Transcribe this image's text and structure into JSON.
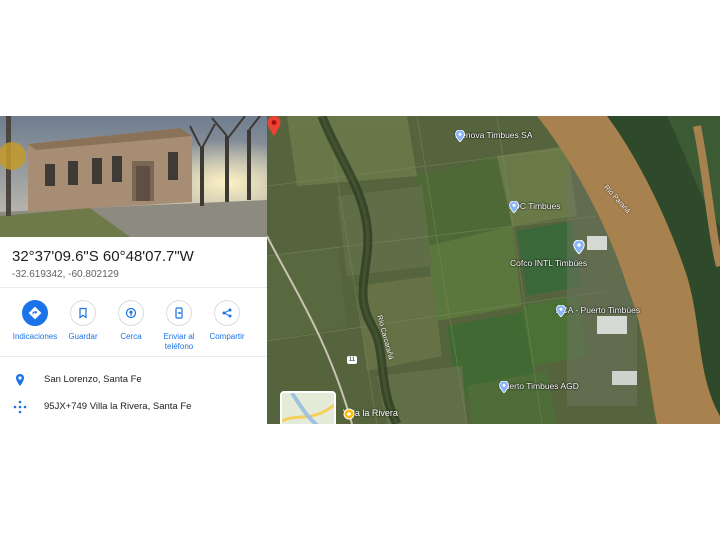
{
  "place": {
    "coordinates_dms": "32°37'09.6\"S 60°48'07.7\"W",
    "coordinates_decimal": "-32.619342, -60.802129"
  },
  "actions": [
    {
      "label": "Indicaciones",
      "icon": "directions-icon"
    },
    {
      "label": "Guardar",
      "icon": "bookmark-icon"
    },
    {
      "label": "Cerca",
      "icon": "nearby-icon"
    },
    {
      "label": "Enviar al teléfono",
      "icon": "send-to-phone-icon"
    },
    {
      "label": "Compartir",
      "icon": "share-icon"
    }
  ],
  "info": {
    "address": "San Lorenzo, Santa Fe",
    "plus_code": "95JX+749 Villa la Rivera, Santa Fe"
  },
  "map": {
    "pois": [
      {
        "name": "Renova Timbues SA"
      },
      {
        "name": "LDC Timbues"
      },
      {
        "name": "Cofco INTL Timbúes"
      },
      {
        "name": "ACA - Puerto Timbúes"
      },
      {
        "name": "Puerto Timbues AGD"
      }
    ],
    "labels": {
      "river": "Río Paraná",
      "stream": "Río Carcarañá",
      "route": "11",
      "town": "Villa la Rivera"
    }
  },
  "colors": {
    "accent": "#1a73e8",
    "pin_red": "#ea4335",
    "poi_pin": "#8ab4f8",
    "town_pin": "#fbbc04",
    "river": "#a7814e"
  }
}
